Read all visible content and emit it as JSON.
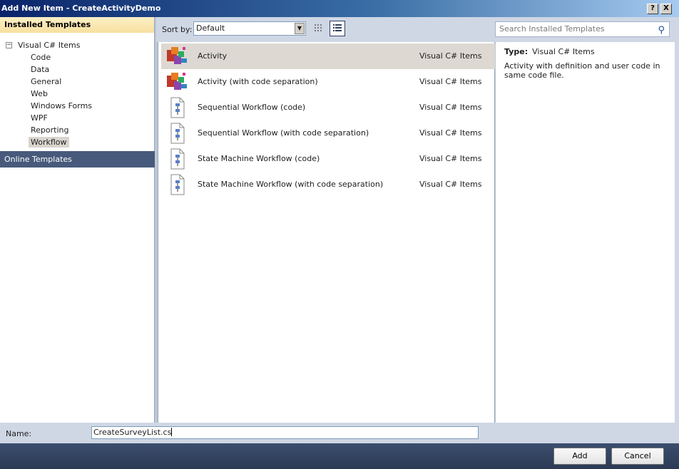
{
  "window": {
    "title": "Add New Item - CreateActivityDemo",
    "help_label": "?",
    "close_label": "X"
  },
  "left": {
    "installed_header": "Installed Templates",
    "root_label": "Visual C# Items",
    "root_expander": "−",
    "items": [
      "Code",
      "Data",
      "General",
      "Web",
      "Windows Forms",
      "WPF",
      "Reporting",
      "Workflow"
    ],
    "selected_index": 7,
    "online_header": "Online Templates"
  },
  "toolbar": {
    "sort_label": "Sort by:",
    "sort_value": "Default",
    "search_placeholder": "Search Installed Templates"
  },
  "templates": [
    {
      "name": "Activity",
      "category": "Visual C# Items",
      "icon": "activity-icon"
    },
    {
      "name": "Activity (with code separation)",
      "category": "Visual C# Items",
      "icon": "activity-icon"
    },
    {
      "name": "Sequential Workflow (code)",
      "category": "Visual C# Items",
      "icon": "workflow-file-icon"
    },
    {
      "name": "Sequential Workflow (with code separation)",
      "category": "Visual C# Items",
      "icon": "workflow-file-icon"
    },
    {
      "name": "State Machine Workflow (code)",
      "category": "Visual C# Items",
      "icon": "workflow-file-icon"
    },
    {
      "name": "State Machine Workflow (with code separation)",
      "category": "Visual C# Items",
      "icon": "workflow-file-icon"
    }
  ],
  "selected_template": 0,
  "description": {
    "type_key": "Type:",
    "type_value": "Visual C# Items",
    "text": "Activity with definition and user code in same code file."
  },
  "name_field": {
    "label": "Name:",
    "value": "CreateSurveyList.cs"
  },
  "buttons": {
    "add": "Add",
    "cancel": "Cancel"
  }
}
